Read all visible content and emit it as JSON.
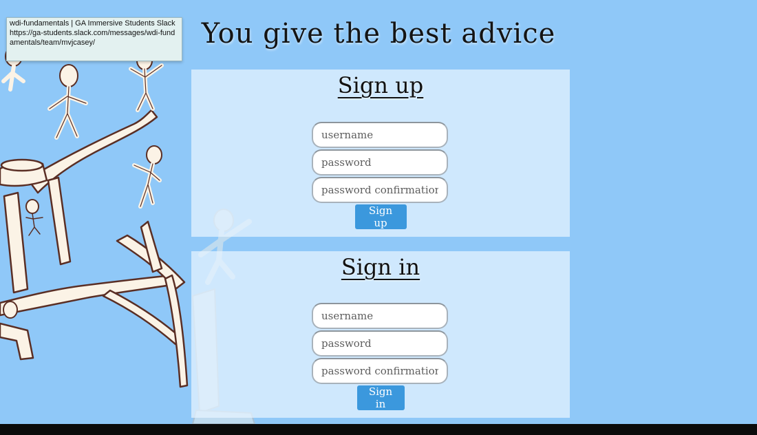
{
  "tooltip": {
    "title": "wdi-fundamentals | GA Immersive Students Slack",
    "url": "https://ga-students.slack.com/messages/wdi-fundamentals/team/mvjcasey/"
  },
  "page": {
    "title": "You give the best advice"
  },
  "signup": {
    "heading": "Sign up",
    "username_placeholder": "username",
    "password_placeholder": "password",
    "confirmation_placeholder": "password confirmation",
    "button_label": "Sign up"
  },
  "signin": {
    "heading": "Sign in",
    "username_placeholder": "username",
    "password_placeholder": "password",
    "confirmation_placeholder": "password confirmation",
    "button_label": "Sign in"
  },
  "colors": {
    "background": "#8fc8f8",
    "button": "#3b98dd",
    "panel": "#e8f4ff"
  }
}
